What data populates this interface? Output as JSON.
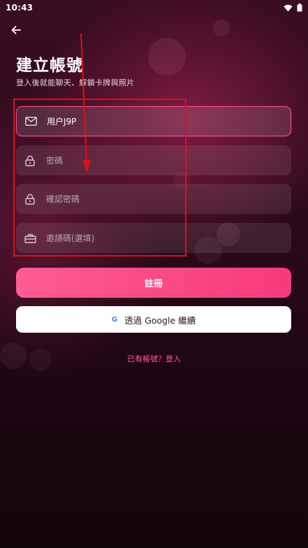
{
  "status_bar": {
    "time": "10:43"
  },
  "header": {
    "title": "建立帳號",
    "subtitle": "登入後就能聊天、解鎖卡牌與照片"
  },
  "form": {
    "username": {
      "value": "用户J9P",
      "icon": "mail-icon"
    },
    "password": {
      "placeholder": "密碼",
      "icon": "lock-icon"
    },
    "confirm_password": {
      "placeholder": "確認密碼",
      "icon": "lock-icon"
    },
    "invite_code": {
      "placeholder": "邀請碼(選填)",
      "icon": "ticket-icon"
    }
  },
  "buttons": {
    "register_label": "註冊",
    "google_letter": "G",
    "google_label": "透過 Google 繼續"
  },
  "footer": {
    "login_link": "已有帳號？登入"
  },
  "colors": {
    "accent": "#f63a7b",
    "highlight_box": "#e01010",
    "background_top": "#3a0d22",
    "background_bottom": "#120509"
  }
}
